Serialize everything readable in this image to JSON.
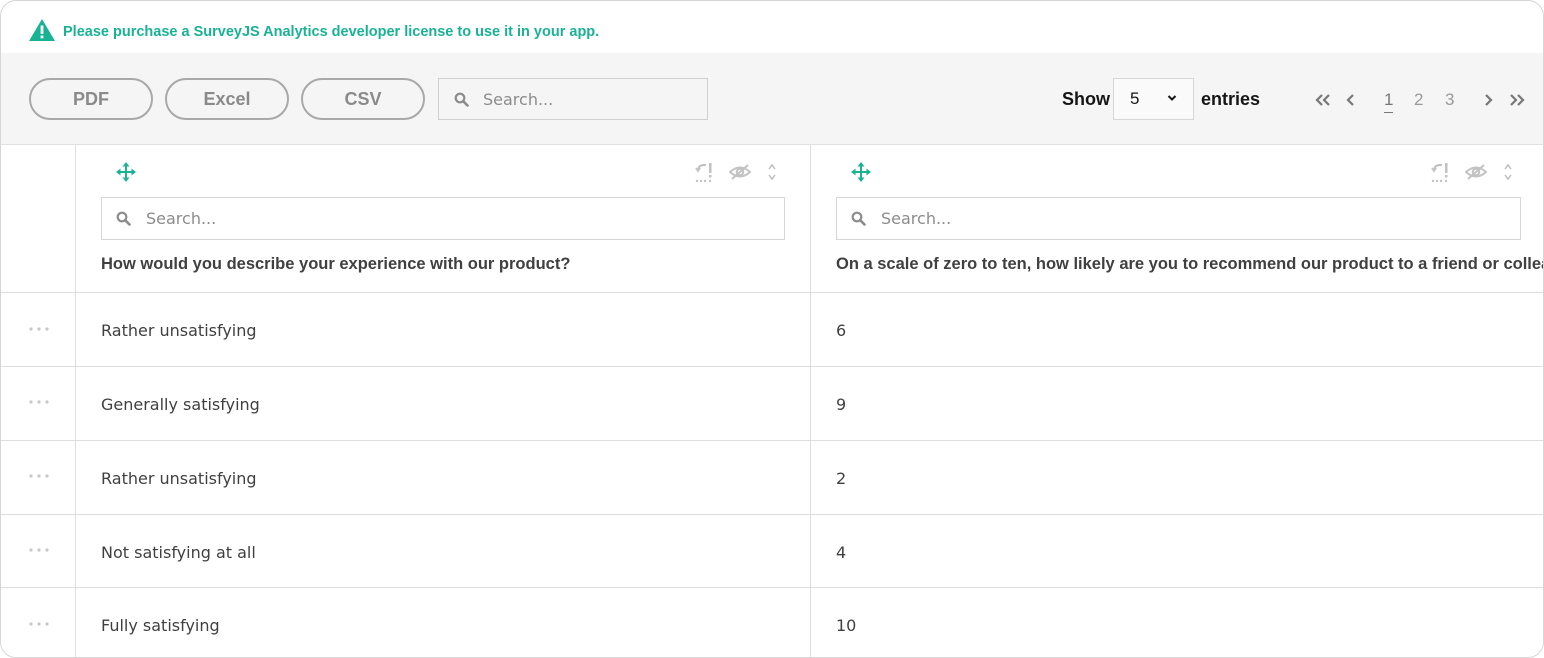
{
  "banner": {
    "icon": "warning-icon",
    "text": "Please purchase a SurveyJS Analytics developer license to use it in your app."
  },
  "toolbar": {
    "export_buttons": [
      "PDF",
      "Excel",
      "CSV"
    ],
    "search_placeholder": "Search...",
    "show_label": "Show",
    "entries_value": "5",
    "entries_label": "entries",
    "pages": [
      "1",
      "2",
      "3"
    ],
    "current_page": "1"
  },
  "columns": [
    {
      "search_placeholder": "Search...",
      "title": "How would you describe your experience with our product?"
    },
    {
      "search_placeholder": "Search...",
      "title": "On a scale of zero to ten, how likely are you to recommend our product to a friend or colleague?"
    }
  ],
  "rows": [
    [
      "Rather unsatisfying",
      "6"
    ],
    [
      "Generally satisfying",
      "9"
    ],
    [
      "Rather unsatisfying",
      "2"
    ],
    [
      "Not satisfying at all",
      "4"
    ],
    [
      "Fully satisfying",
      "10"
    ]
  ],
  "colors": {
    "accent": "#19b394",
    "toolbar_bg": "#f5f5f5",
    "border": "#dedede",
    "text": "#404040"
  }
}
